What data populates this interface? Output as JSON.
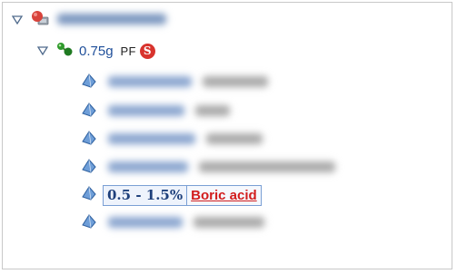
{
  "tree": {
    "root": {
      "expanded": true,
      "label_obscured": true
    },
    "group": {
      "expanded": true,
      "amount": "0.75g",
      "tag": "PF",
      "badge": "S"
    },
    "items": [
      {
        "obscured": true
      },
      {
        "obscured": true
      },
      {
        "obscured": true
      },
      {
        "obscured": true
      },
      {
        "obscured": false,
        "range": "0.5 - 1.5%",
        "name": "Boric acid"
      },
      {
        "obscured": true
      }
    ]
  },
  "colors": {
    "accent_blue": "#1f4f9a",
    "link_red": "#d21c1c",
    "badge_red": "#d8332d",
    "selection_border": "#7a9fd4"
  }
}
